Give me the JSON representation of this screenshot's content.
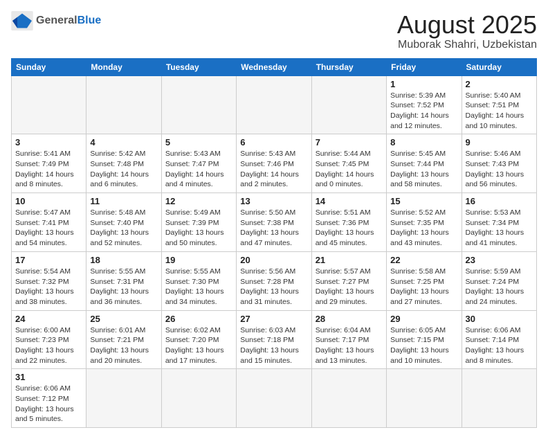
{
  "header": {
    "logo_general": "General",
    "logo_blue": "Blue",
    "title": "August 2025",
    "subtitle": "Muborak Shahri, Uzbekistan"
  },
  "weekdays": [
    "Sunday",
    "Monday",
    "Tuesday",
    "Wednesday",
    "Thursday",
    "Friday",
    "Saturday"
  ],
  "weeks": [
    [
      {
        "day": "",
        "info": ""
      },
      {
        "day": "",
        "info": ""
      },
      {
        "day": "",
        "info": ""
      },
      {
        "day": "",
        "info": ""
      },
      {
        "day": "",
        "info": ""
      },
      {
        "day": "1",
        "info": "Sunrise: 5:39 AM\nSunset: 7:52 PM\nDaylight: 14 hours and 12 minutes."
      },
      {
        "day": "2",
        "info": "Sunrise: 5:40 AM\nSunset: 7:51 PM\nDaylight: 14 hours and 10 minutes."
      }
    ],
    [
      {
        "day": "3",
        "info": "Sunrise: 5:41 AM\nSunset: 7:49 PM\nDaylight: 14 hours and 8 minutes."
      },
      {
        "day": "4",
        "info": "Sunrise: 5:42 AM\nSunset: 7:48 PM\nDaylight: 14 hours and 6 minutes."
      },
      {
        "day": "5",
        "info": "Sunrise: 5:43 AM\nSunset: 7:47 PM\nDaylight: 14 hours and 4 minutes."
      },
      {
        "day": "6",
        "info": "Sunrise: 5:43 AM\nSunset: 7:46 PM\nDaylight: 14 hours and 2 minutes."
      },
      {
        "day": "7",
        "info": "Sunrise: 5:44 AM\nSunset: 7:45 PM\nDaylight: 14 hours and 0 minutes."
      },
      {
        "day": "8",
        "info": "Sunrise: 5:45 AM\nSunset: 7:44 PM\nDaylight: 13 hours and 58 minutes."
      },
      {
        "day": "9",
        "info": "Sunrise: 5:46 AM\nSunset: 7:43 PM\nDaylight: 13 hours and 56 minutes."
      }
    ],
    [
      {
        "day": "10",
        "info": "Sunrise: 5:47 AM\nSunset: 7:41 PM\nDaylight: 13 hours and 54 minutes."
      },
      {
        "day": "11",
        "info": "Sunrise: 5:48 AM\nSunset: 7:40 PM\nDaylight: 13 hours and 52 minutes."
      },
      {
        "day": "12",
        "info": "Sunrise: 5:49 AM\nSunset: 7:39 PM\nDaylight: 13 hours and 50 minutes."
      },
      {
        "day": "13",
        "info": "Sunrise: 5:50 AM\nSunset: 7:38 PM\nDaylight: 13 hours and 47 minutes."
      },
      {
        "day": "14",
        "info": "Sunrise: 5:51 AM\nSunset: 7:36 PM\nDaylight: 13 hours and 45 minutes."
      },
      {
        "day": "15",
        "info": "Sunrise: 5:52 AM\nSunset: 7:35 PM\nDaylight: 13 hours and 43 minutes."
      },
      {
        "day": "16",
        "info": "Sunrise: 5:53 AM\nSunset: 7:34 PM\nDaylight: 13 hours and 41 minutes."
      }
    ],
    [
      {
        "day": "17",
        "info": "Sunrise: 5:54 AM\nSunset: 7:32 PM\nDaylight: 13 hours and 38 minutes."
      },
      {
        "day": "18",
        "info": "Sunrise: 5:55 AM\nSunset: 7:31 PM\nDaylight: 13 hours and 36 minutes."
      },
      {
        "day": "19",
        "info": "Sunrise: 5:55 AM\nSunset: 7:30 PM\nDaylight: 13 hours and 34 minutes."
      },
      {
        "day": "20",
        "info": "Sunrise: 5:56 AM\nSunset: 7:28 PM\nDaylight: 13 hours and 31 minutes."
      },
      {
        "day": "21",
        "info": "Sunrise: 5:57 AM\nSunset: 7:27 PM\nDaylight: 13 hours and 29 minutes."
      },
      {
        "day": "22",
        "info": "Sunrise: 5:58 AM\nSunset: 7:25 PM\nDaylight: 13 hours and 27 minutes."
      },
      {
        "day": "23",
        "info": "Sunrise: 5:59 AM\nSunset: 7:24 PM\nDaylight: 13 hours and 24 minutes."
      }
    ],
    [
      {
        "day": "24",
        "info": "Sunrise: 6:00 AM\nSunset: 7:23 PM\nDaylight: 13 hours and 22 minutes."
      },
      {
        "day": "25",
        "info": "Sunrise: 6:01 AM\nSunset: 7:21 PM\nDaylight: 13 hours and 20 minutes."
      },
      {
        "day": "26",
        "info": "Sunrise: 6:02 AM\nSunset: 7:20 PM\nDaylight: 13 hours and 17 minutes."
      },
      {
        "day": "27",
        "info": "Sunrise: 6:03 AM\nSunset: 7:18 PM\nDaylight: 13 hours and 15 minutes."
      },
      {
        "day": "28",
        "info": "Sunrise: 6:04 AM\nSunset: 7:17 PM\nDaylight: 13 hours and 13 minutes."
      },
      {
        "day": "29",
        "info": "Sunrise: 6:05 AM\nSunset: 7:15 PM\nDaylight: 13 hours and 10 minutes."
      },
      {
        "day": "30",
        "info": "Sunrise: 6:06 AM\nSunset: 7:14 PM\nDaylight: 13 hours and 8 minutes."
      }
    ],
    [
      {
        "day": "31",
        "info": "Sunrise: 6:06 AM\nSunset: 7:12 PM\nDaylight: 13 hours and 5 minutes."
      },
      {
        "day": "",
        "info": ""
      },
      {
        "day": "",
        "info": ""
      },
      {
        "day": "",
        "info": ""
      },
      {
        "day": "",
        "info": ""
      },
      {
        "day": "",
        "info": ""
      },
      {
        "day": "",
        "info": ""
      }
    ]
  ]
}
